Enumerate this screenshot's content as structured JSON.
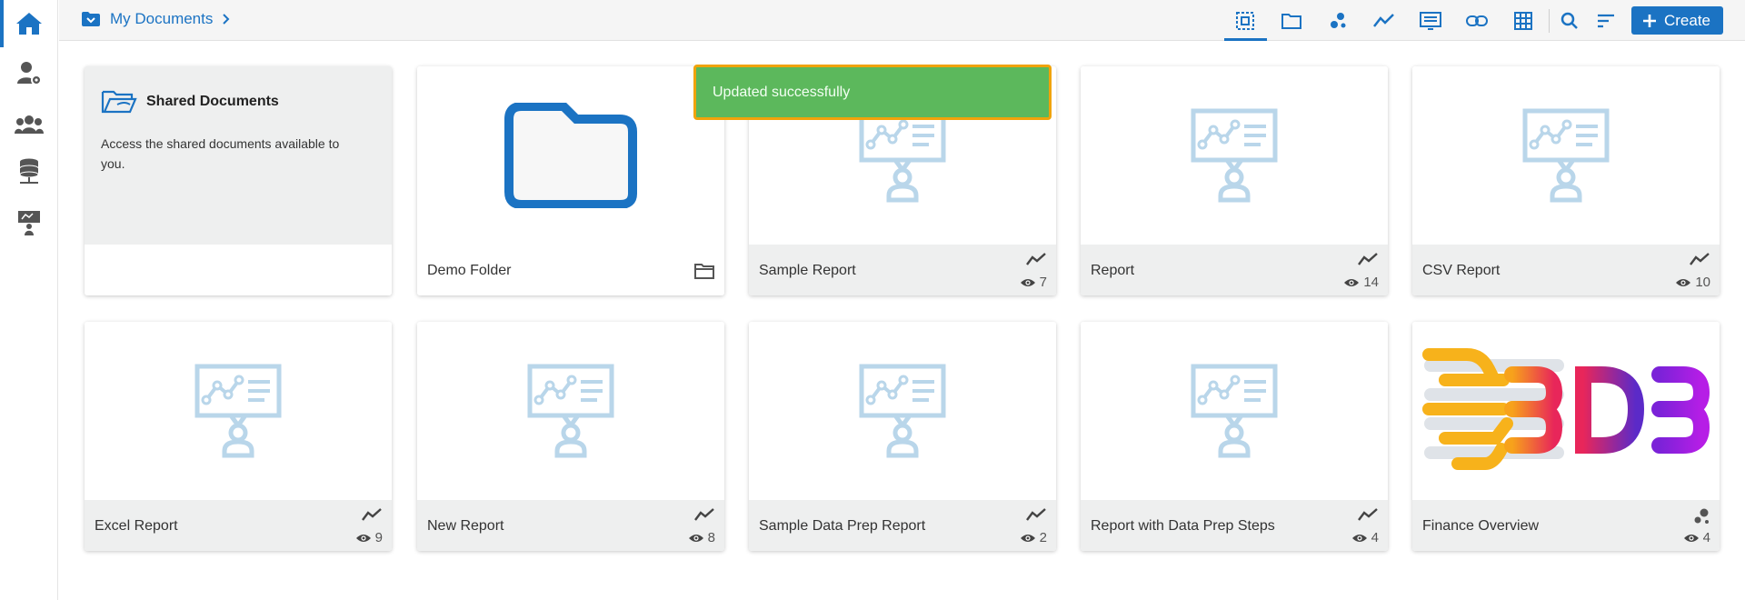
{
  "sidebar": {
    "items": [
      {
        "icon": "home-icon",
        "active": true
      },
      {
        "icon": "user-settings-icon"
      },
      {
        "icon": "users-group-icon"
      },
      {
        "icon": "database-icon"
      },
      {
        "icon": "presentation-icon"
      }
    ]
  },
  "breadcrumb": {
    "label": "My Documents"
  },
  "toolbar": {
    "tools": [
      "select-all-icon",
      "folder-icon",
      "scatter-icon",
      "line-chart-icon",
      "list-icon",
      "link-icon",
      "grid-icon",
      "search-icon",
      "sort-icon"
    ],
    "create_label": "Create"
  },
  "toast": {
    "message": "Updated successfully"
  },
  "shared": {
    "title": "Shared Documents",
    "description": "Access the shared documents available to you."
  },
  "cards": [
    {
      "name": "Demo Folder",
      "kind": "folder"
    },
    {
      "name": "Sample Report",
      "kind": "report",
      "views": "7"
    },
    {
      "name": "Report",
      "kind": "report",
      "views": "14"
    },
    {
      "name": "CSV Report",
      "kind": "report",
      "views": "10"
    },
    {
      "name": "Excel Report",
      "kind": "report",
      "views": "9"
    },
    {
      "name": "New Report",
      "kind": "report",
      "views": "8"
    },
    {
      "name": "Sample Data Prep Report",
      "kind": "report",
      "views": "2"
    },
    {
      "name": "Report with Data Prep Steps",
      "kind": "report",
      "views": "4"
    },
    {
      "name": "Finance Overview",
      "kind": "story",
      "views": "4"
    }
  ],
  "colors": {
    "accent": "#1b73c3",
    "thumb_icon": "#b9d6ea",
    "toast_bg": "#5cb85c",
    "toast_border": "#f0a30a"
  }
}
